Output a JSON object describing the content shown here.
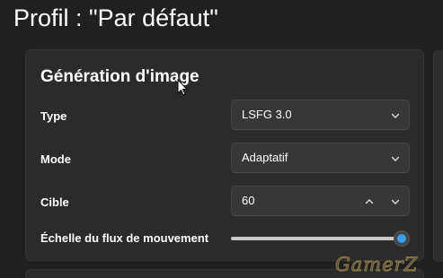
{
  "page": {
    "title": "Profil : \"Par défaut\""
  },
  "section": {
    "title": "Génération d'image",
    "type": {
      "label": "Type",
      "value": "LSFG 3.0"
    },
    "mode": {
      "label": "Mode",
      "value": "Adaptatif"
    },
    "target": {
      "label": "Cible",
      "value": "60"
    },
    "flow_scale": {
      "label": "Échelle du flux de mouvement",
      "value_fraction": 1.0
    }
  },
  "watermark": "GamerZ",
  "colors": {
    "accent": "#3a9ff0",
    "background": "#202020",
    "card": "#2b2b2b"
  },
  "icons": [
    "chevron-down-icon",
    "chevron-up-icon",
    "mouse-pointer-icon"
  ]
}
